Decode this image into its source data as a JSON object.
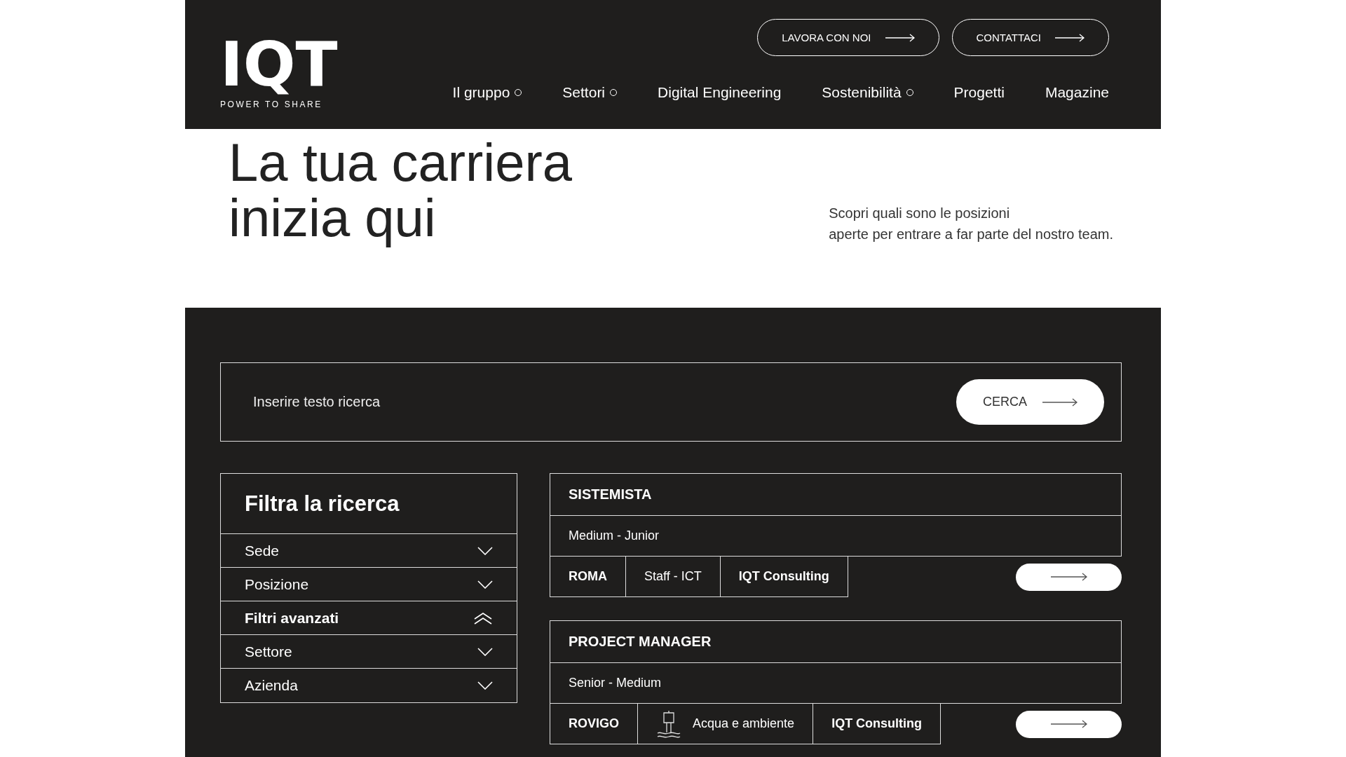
{
  "header": {
    "logo": {
      "mark": "IQT",
      "tagline": "POWER TO SHARE"
    },
    "actions": [
      {
        "label": "LAVORA CON NOI"
      },
      {
        "label": "CONTATTACI"
      }
    ],
    "nav": [
      {
        "label": "Il gruppo",
        "has_submenu": true
      },
      {
        "label": "Settori",
        "has_submenu": true
      },
      {
        "label": "Digital Engineering",
        "has_submenu": false
      },
      {
        "label": "Sostenibilità",
        "has_submenu": true
      },
      {
        "label": "Progetti",
        "has_submenu": false
      },
      {
        "label": "Magazine",
        "has_submenu": false
      }
    ]
  },
  "hero": {
    "title_lines": [
      "La tua carriera",
      "inizia qui"
    ],
    "intro_lines": [
      "Scopri quali sono le posizioni",
      "aperte per entrare a far parte del nostro team."
    ]
  },
  "search": {
    "placeholder": "Inserire testo ricerca",
    "button": "CERCA"
  },
  "filters": {
    "title": "Filtra la ricerca",
    "items": [
      {
        "label": "Sede",
        "expanded": false
      },
      {
        "label": "Posizione",
        "expanded": false
      },
      {
        "label": "Filtri avanzati",
        "expanded": true
      },
      {
        "label": "Settore",
        "expanded": false
      },
      {
        "label": "Azienda",
        "expanded": false
      }
    ]
  },
  "jobs": [
    {
      "title": "SISTEMISTA",
      "level": "Medium - Junior",
      "tags": [
        {
          "kind": "location",
          "label": "ROMA"
        },
        {
          "kind": "sector",
          "label": "Staff - ICT",
          "has_icon": false
        },
        {
          "kind": "company",
          "label": "IQT Consulting"
        }
      ]
    },
    {
      "title": "PROJECT MANAGER",
      "level": "Senior - Medium",
      "tags": [
        {
          "kind": "location",
          "label": "ROVIGO"
        },
        {
          "kind": "sector",
          "label": "Acqua e ambiente",
          "has_icon": true
        },
        {
          "kind": "company",
          "label": "IQT Consulting"
        }
      ]
    }
  ]
}
